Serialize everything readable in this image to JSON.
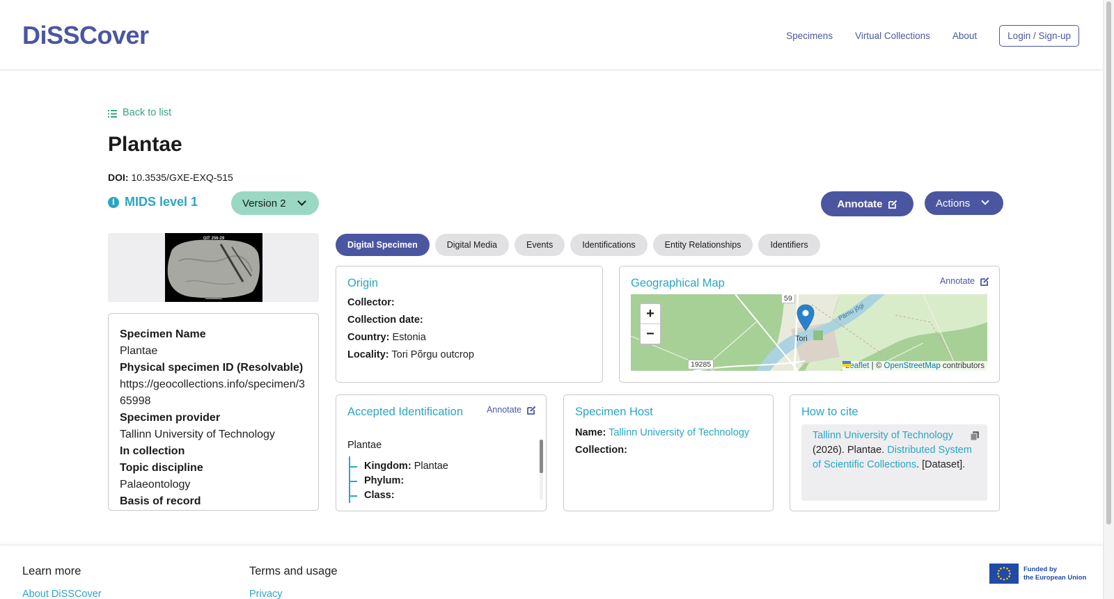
{
  "header": {
    "logo": "DiSSCover",
    "nav": [
      "Specimens",
      "Virtual Collections",
      "About"
    ],
    "login": "Login / Sign-up"
  },
  "back": {
    "label": "Back to list"
  },
  "specimen": {
    "title": "Plantae",
    "doi_label": "DOI:",
    "doi": "10.3535/GXE-EXQ-515",
    "mids": "MIDS level 1",
    "version": "Version 2",
    "annotate": "Annotate",
    "actions": "Actions",
    "image_label": "GIT 256-29"
  },
  "details": [
    {
      "h": "Specimen Name",
      "v": "Plantae"
    },
    {
      "h": "Physical specimen ID (Resolvable)",
      "v": "https://geocollections.info/specimen/365998"
    },
    {
      "h": "Specimen provider",
      "v": "Tallinn University of Technology"
    },
    {
      "h": "In collection",
      "v": ""
    },
    {
      "h": "Topic discipline",
      "v": "Palaeontology"
    },
    {
      "h": "Basis of record",
      "v": ""
    }
  ],
  "tabs": [
    "Digital Specimen",
    "Digital Media",
    "Events",
    "Identifications",
    "Entity Relationships",
    "Identifiers"
  ],
  "origin": {
    "title": "Origin",
    "collector_label": "Collector:",
    "collector": "",
    "date_label": "Collection date:",
    "date": "",
    "country_label": "Country:",
    "country": "Estonia",
    "locality_label": "Locality:",
    "locality": "Tori Põrgu outcrop"
  },
  "geo": {
    "title": "Geographical Map",
    "annotate": "Annotate",
    "zoom_in": "+",
    "zoom_out": "−",
    "attr_leaflet": "Leaflet",
    "attr_sep": " | © ",
    "attr_osm": "OpenStreetMap",
    "attr_tail": " contributors",
    "road_59": "59",
    "road_19285": "19285",
    "town": "Tori",
    "river": "Pärnu jõgi"
  },
  "accepted": {
    "title": "Accepted Identification",
    "annotate": "Annotate",
    "root": "Plantae",
    "kingdom_label": "Kingdom:",
    "kingdom": "Plantae",
    "phylum_label": "Phylum:",
    "class_label": "Class:"
  },
  "host": {
    "title": "Specimen Host",
    "name_label": "Name:",
    "name": "Tallinn University of Technology",
    "collection_label": "Collection:"
  },
  "cite": {
    "title": "How to cite",
    "org": "Tallinn University of Technology",
    "year_text": " (2026). Plantae. ",
    "system": "Distributed System of Scientific Collections",
    "tail": ". [Dataset]."
  },
  "footer": {
    "learn_more": "Learn more",
    "about": "About DiSSCover",
    "terms": "Terms and usage",
    "privacy": "Privacy",
    "eu_line1": "Funded by",
    "eu_line2": "the European Union"
  },
  "colors": {
    "brand": "#4b56a1",
    "accent": "#29a6c4",
    "green": "#38a389"
  }
}
